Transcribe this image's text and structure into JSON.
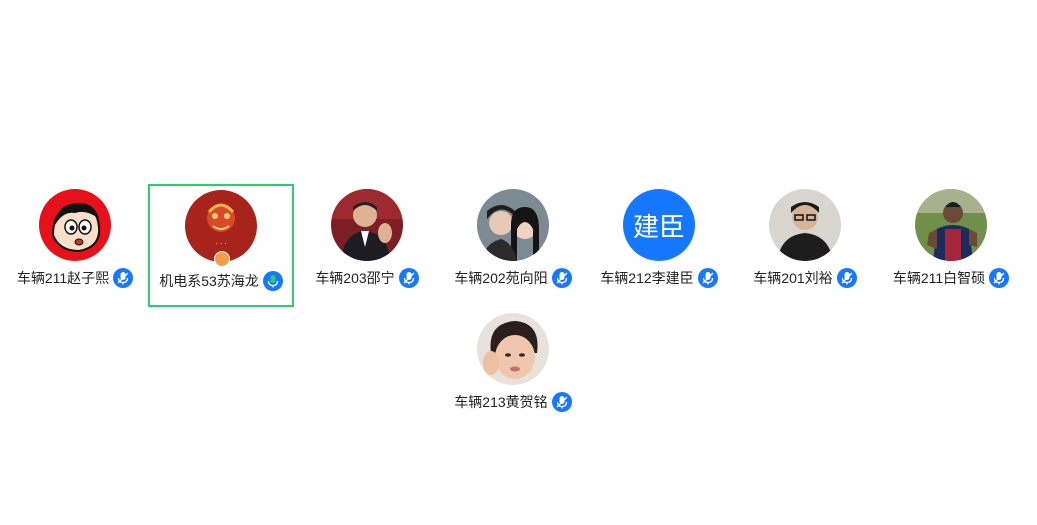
{
  "participants": [
    {
      "name": "车辆211赵子熙",
      "avatar_icon": "cartoon-boy-avatar",
      "mic_state": "muted",
      "selected": false
    },
    {
      "name": "机电系53苏海龙",
      "avatar_icon": "lion-dance-avatar",
      "mic_state": "speaking",
      "selected": true,
      "role_badge": "host-badge-icon"
    },
    {
      "name": "车辆203邵宁",
      "avatar_icon": "man-in-suit-avatar",
      "mic_state": "muted",
      "selected": false
    },
    {
      "name": "车辆202苑向阳",
      "avatar_icon": "couple-photo-avatar",
      "mic_state": "muted",
      "selected": false
    },
    {
      "name": "车辆212李建臣",
      "avatar_text": "建臣",
      "avatar_color": "#1677ff",
      "mic_state": "muted",
      "selected": false
    },
    {
      "name": "车辆201刘裕",
      "avatar_icon": "man-with-glasses-avatar",
      "mic_state": "muted",
      "selected": false
    },
    {
      "name": "车辆211白智硕",
      "avatar_icon": "soccer-player-avatar",
      "mic_state": "muted",
      "selected": false
    },
    {
      "name": "车辆213黄贺铭",
      "avatar_icon": "child-photo-avatar",
      "mic_state": "muted",
      "selected": false
    }
  ],
  "colors": {
    "selected_border": "#2ecc71",
    "mic_muted": "#1677ff",
    "mic_speaking": "#2ecc71",
    "text": "#222222"
  }
}
